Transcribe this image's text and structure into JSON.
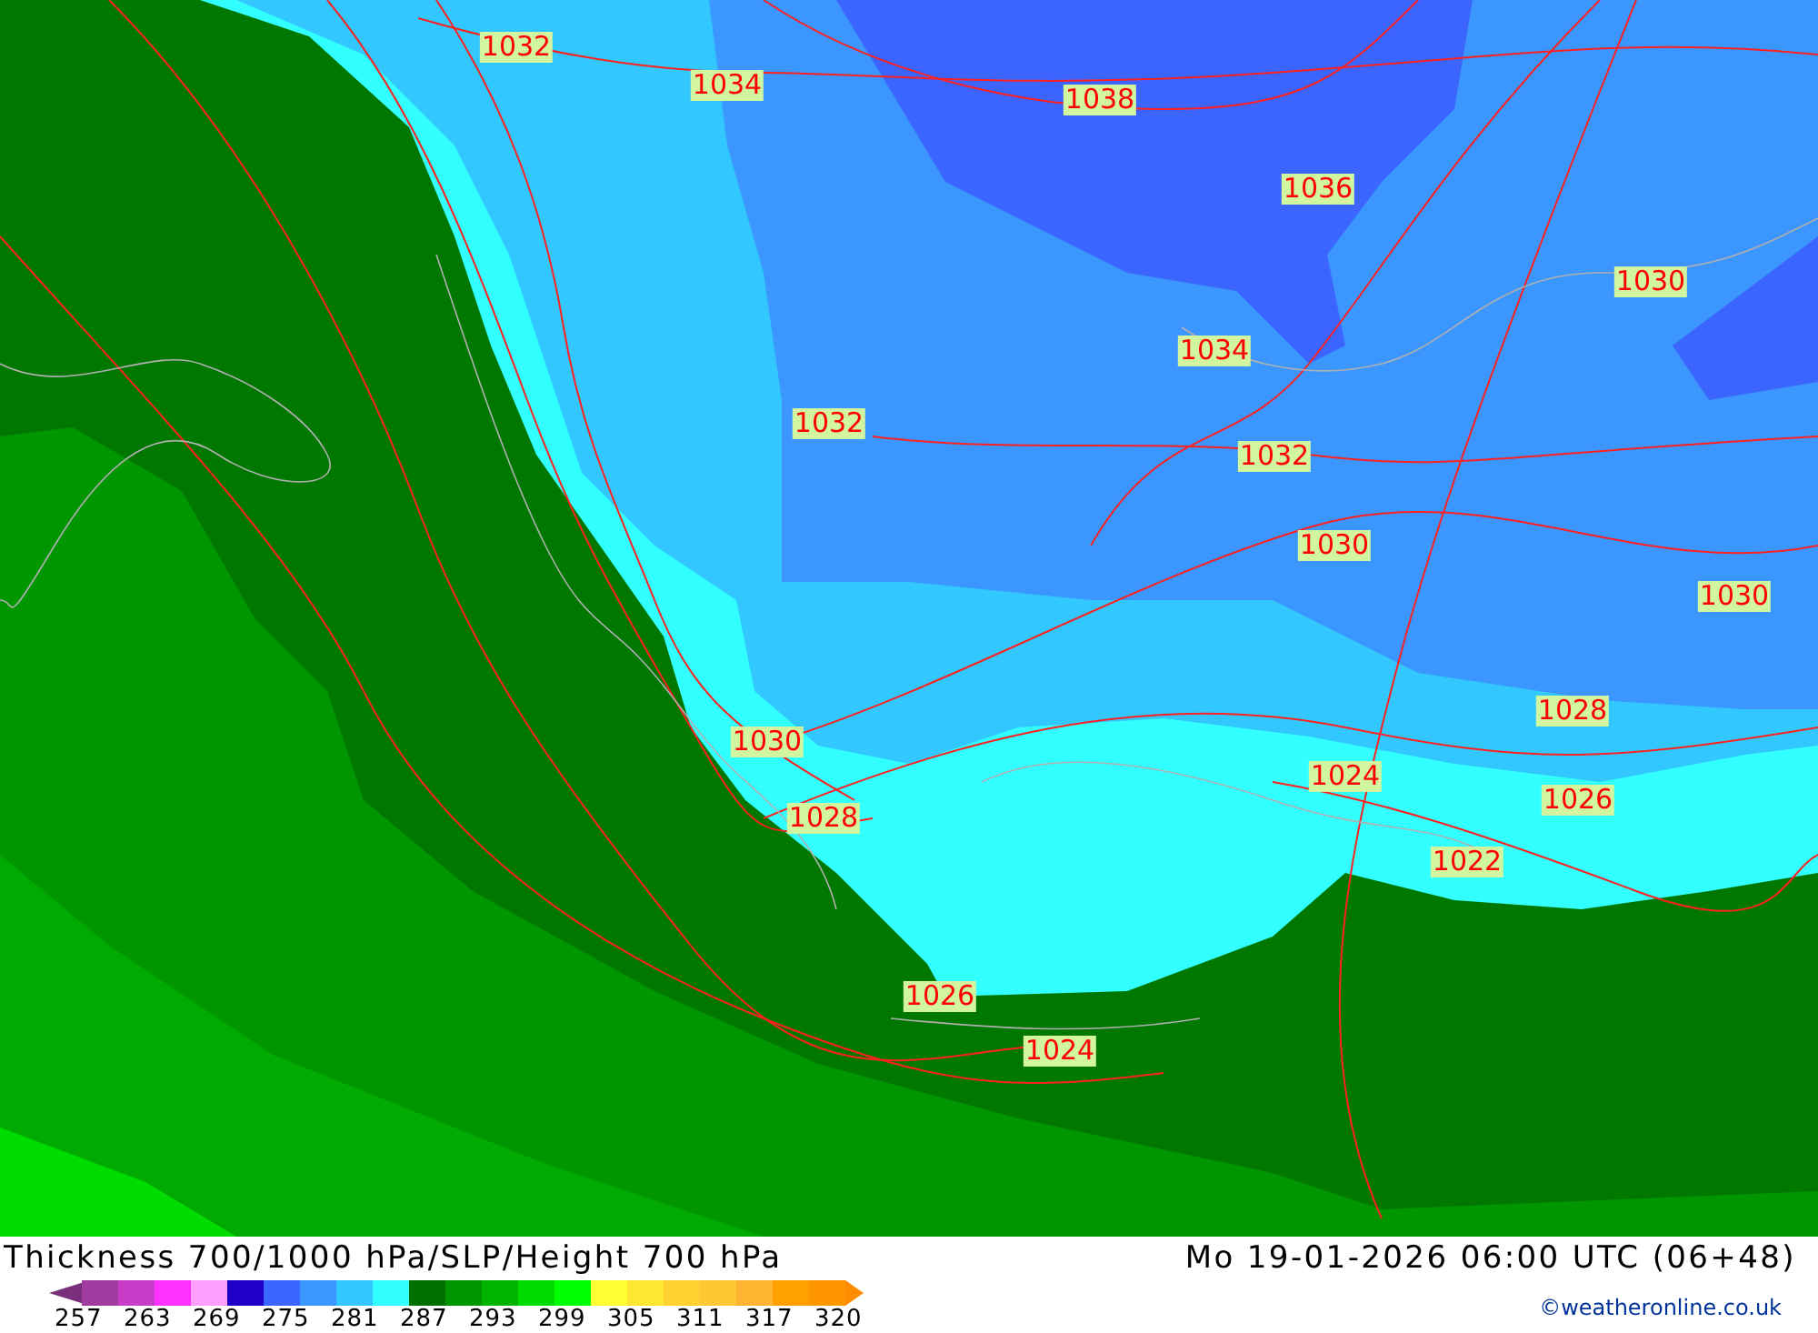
{
  "map": {
    "isobar_labels": [
      {
        "text": "1032"
      },
      {
        "text": "1034"
      },
      {
        "text": "1038"
      },
      {
        "text": "1036"
      },
      {
        "text": "1030"
      },
      {
        "text": "1034"
      },
      {
        "text": "1032"
      },
      {
        "text": "1032"
      },
      {
        "text": "1030"
      },
      {
        "text": "1030"
      },
      {
        "text": "1028"
      },
      {
        "text": "1030"
      },
      {
        "text": "1024"
      },
      {
        "text": "1026"
      },
      {
        "text": "1028"
      },
      {
        "text": "1022"
      },
      {
        "text": "1026"
      },
      {
        "text": "1024"
      }
    ]
  },
  "footer": {
    "title": "Thickness 700/1000 hPa/SLP/Height 700 hPa",
    "valid_time": "Mo 19-01-2026 06:00 UTC (06+48)",
    "legend": {
      "swatches": [
        {
          "kind": "arrow-left",
          "color": "#7a2f7a"
        },
        {
          "kind": "cell",
          "color": "#a03ca0"
        },
        {
          "kind": "cell",
          "color": "#c83cc8"
        },
        {
          "kind": "cell",
          "color": "#ff32ff"
        },
        {
          "kind": "cell",
          "color": "#ffa0ff"
        },
        {
          "kind": "cell",
          "color": "#1e00c8"
        },
        {
          "kind": "cell",
          "color": "#3c64ff"
        },
        {
          "kind": "cell",
          "color": "#3c96ff"
        },
        {
          "kind": "cell",
          "color": "#32c8ff"
        },
        {
          "kind": "cell",
          "color": "#32ffff"
        },
        {
          "kind": "cell",
          "color": "#007000"
        },
        {
          "kind": "cell",
          "color": "#009600"
        },
        {
          "kind": "cell",
          "color": "#00b400"
        },
        {
          "kind": "cell",
          "color": "#00dc00"
        },
        {
          "kind": "cell",
          "color": "#00ff00"
        },
        {
          "kind": "cell",
          "color": "#ffff32"
        },
        {
          "kind": "cell",
          "color": "#ffe632"
        },
        {
          "kind": "cell",
          "color": "#ffd232"
        },
        {
          "kind": "cell",
          "color": "#ffc832"
        },
        {
          "kind": "cell",
          "color": "#ffb432"
        },
        {
          "kind": "cell",
          "color": "#ffa000"
        },
        {
          "kind": "cell",
          "color": "#ff9600"
        },
        {
          "kind": "arrow-right",
          "color": "#ff8c00"
        }
      ],
      "ticks": [
        "257",
        "263",
        "269",
        "275",
        "281",
        "287",
        "293",
        "299",
        "305",
        "311",
        "317",
        "320"
      ]
    },
    "credit": "©weatheronline.co.uk"
  }
}
